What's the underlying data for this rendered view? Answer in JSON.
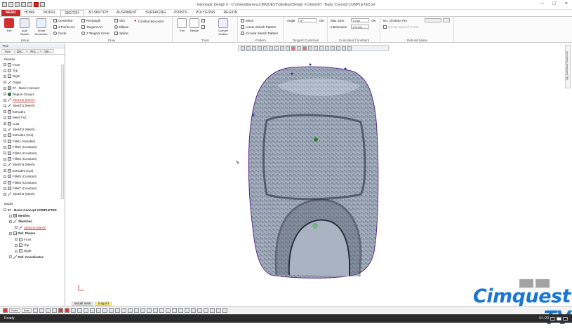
{
  "window": {
    "title": "Geomagic Design X - C:\\Users\\jbarrera.CIMQUEST\\Desktop\\Design X Demo\\07 - Basic Concept COMPLETED.xrl"
  },
  "menu": [
    "MENU",
    "HOME",
    "MODEL",
    "SKETCH",
    "3D SKETCH",
    "ALIGNMENT",
    "SURFACING",
    "POINTS",
    "POLYGONS",
    "REGION"
  ],
  "ribbon": {
    "setup": {
      "title": "Setup",
      "exit": "Exit",
      "auto_sketch": "Auto Sketch",
      "smart_dimension": "Smart Dimension"
    },
    "draw": {
      "title": "Draw",
      "centerline": "Centerline",
      "three_point_arc": "3 Points Arc",
      "circle": "Circle",
      "rectangle": "Rectangle",
      "tangent_arc": "Tangent Arc",
      "three_tangent_circle": "3 Tangent Circle",
      "slot": "Slot",
      "ellipse": "Ellipse",
      "spline": "Spline",
      "construction_point": "Construction point"
    },
    "tools": {
      "title": "Tools",
      "trim": "Trim",
      "resize": "Resize",
      "convert_entities": "Convert Entities"
    },
    "pattern": {
      "title": "Pattern",
      "mirror": "Mirror",
      "linear": "Linear Sketch Pattern",
      "circular": "Circular Sketch Pattern"
    },
    "tangent": {
      "title": "Tangent Constraint",
      "angle_label": "Angle",
      "angle_value": "5 °",
      "ok": "OK"
    },
    "coincident": {
      "title": "Coincident Constraint",
      "max_dist_label": "Max. Dist.",
      "max_dist_value": "5 mm",
      "intersection_label": "Intersection",
      "intersection_value": "2.5 mm",
      "ok": "OK"
    },
    "rebuild": {
      "title": "Rebuild Spline",
      "interp_label": "No. of Interp. Pts",
      "evenly": "Evenly Spaced Points"
    }
  },
  "tree": {
    "header": "Tree",
    "tabs": [
      "Tree",
      "Dis...",
      "Pro...",
      "Vie..."
    ],
    "feature_label": "Feature",
    "feature_items": [
      {
        "label": "Front",
        "icon": "plane",
        "red": false
      },
      {
        "label": "Top",
        "icon": "plane",
        "red": false
      },
      {
        "label": "Right",
        "icon": "plane",
        "red": false
      },
      {
        "label": "Origin",
        "icon": "origin",
        "red": false
      },
      {
        "label": "07 - Basic Concept",
        "icon": "mesh",
        "red": false
      },
      {
        "label": "Region Group1",
        "icon": "group",
        "red": false
      },
      {
        "label": "Sketch5 (Mesh)",
        "icon": "sketch",
        "red": true
      },
      {
        "label": "Sketch1 (Mesh)",
        "icon": "sketch",
        "red": false
      },
      {
        "label": "Extrude1",
        "icon": "feature",
        "red": false
      },
      {
        "label": "Mesh Fit1",
        "icon": "feature",
        "red": false
      },
      {
        "label": "Cut1",
        "icon": "feature",
        "red": false
      },
      {
        "label": "Sketch2 (Mesh)",
        "icon": "sketch",
        "red": false
      },
      {
        "label": "Extrude2 (Cut)",
        "icon": "feature",
        "red": false
      },
      {
        "label": "Fillet1 (Variable)",
        "icon": "feature",
        "red": false
      },
      {
        "label": "Fillet2 (Constant)",
        "icon": "feature",
        "red": false
      },
      {
        "label": "Fillet4 (Constant)",
        "icon": "feature",
        "red": false
      },
      {
        "label": "Fillet3 (Constant)",
        "icon": "feature",
        "red": false
      },
      {
        "label": "Sketch3 (Mesh)",
        "icon": "sketch",
        "red": false
      },
      {
        "label": "Extrude3 (Cut)",
        "icon": "feature",
        "red": false
      },
      {
        "label": "Fillet5 (Constant)",
        "icon": "feature",
        "red": false
      },
      {
        "label": "Fillet6 (Constant)",
        "icon": "feature",
        "red": false
      },
      {
        "label": "Fillet7 (Constant)",
        "icon": "feature",
        "red": false
      },
      {
        "label": "Sketch4 (Mesh)",
        "icon": "sketch",
        "red": false
      }
    ],
    "model_label": "Model",
    "model_items": [
      {
        "label": "07 - Basic Concept COMPLETED",
        "indent": 0,
        "bold": true,
        "red": false,
        "icon": "none"
      },
      {
        "label": "Meshes",
        "indent": 1,
        "bold": true,
        "red": false,
        "icon": "mesh"
      },
      {
        "label": "Sketches",
        "indent": 1,
        "bold": true,
        "red": false,
        "icon": "sketch"
      },
      {
        "label": "Sketch5 (Mesh)",
        "indent": 2,
        "bold": false,
        "red": true,
        "icon": "sketch"
      },
      {
        "label": "Ref. Planes",
        "indent": 1,
        "bold": true,
        "red": false,
        "icon": "plane"
      },
      {
        "label": "Front",
        "indent": 2,
        "bold": false,
        "red": false,
        "icon": "plane"
      },
      {
        "label": "Top",
        "indent": 2,
        "bold": false,
        "red": false,
        "icon": "plane"
      },
      {
        "label": "Right",
        "indent": 2,
        "bold": false,
        "red": false,
        "icon": "plane"
      },
      {
        "label": "Ref. Coordinates",
        "indent": 1,
        "bold": true,
        "red": false,
        "icon": "origin"
      }
    ]
  },
  "viewport": {
    "tabs": [
      "Model View",
      "Support"
    ],
    "right_panel_label": "Accuracy Analyzer(TM)"
  },
  "bottom": {
    "select1": "Rollin",
    "select2": "Both"
  },
  "status": {
    "text": "Ready",
    "time": "0:1:20"
  },
  "watermark": {
    "text": "Cimquest TV"
  }
}
